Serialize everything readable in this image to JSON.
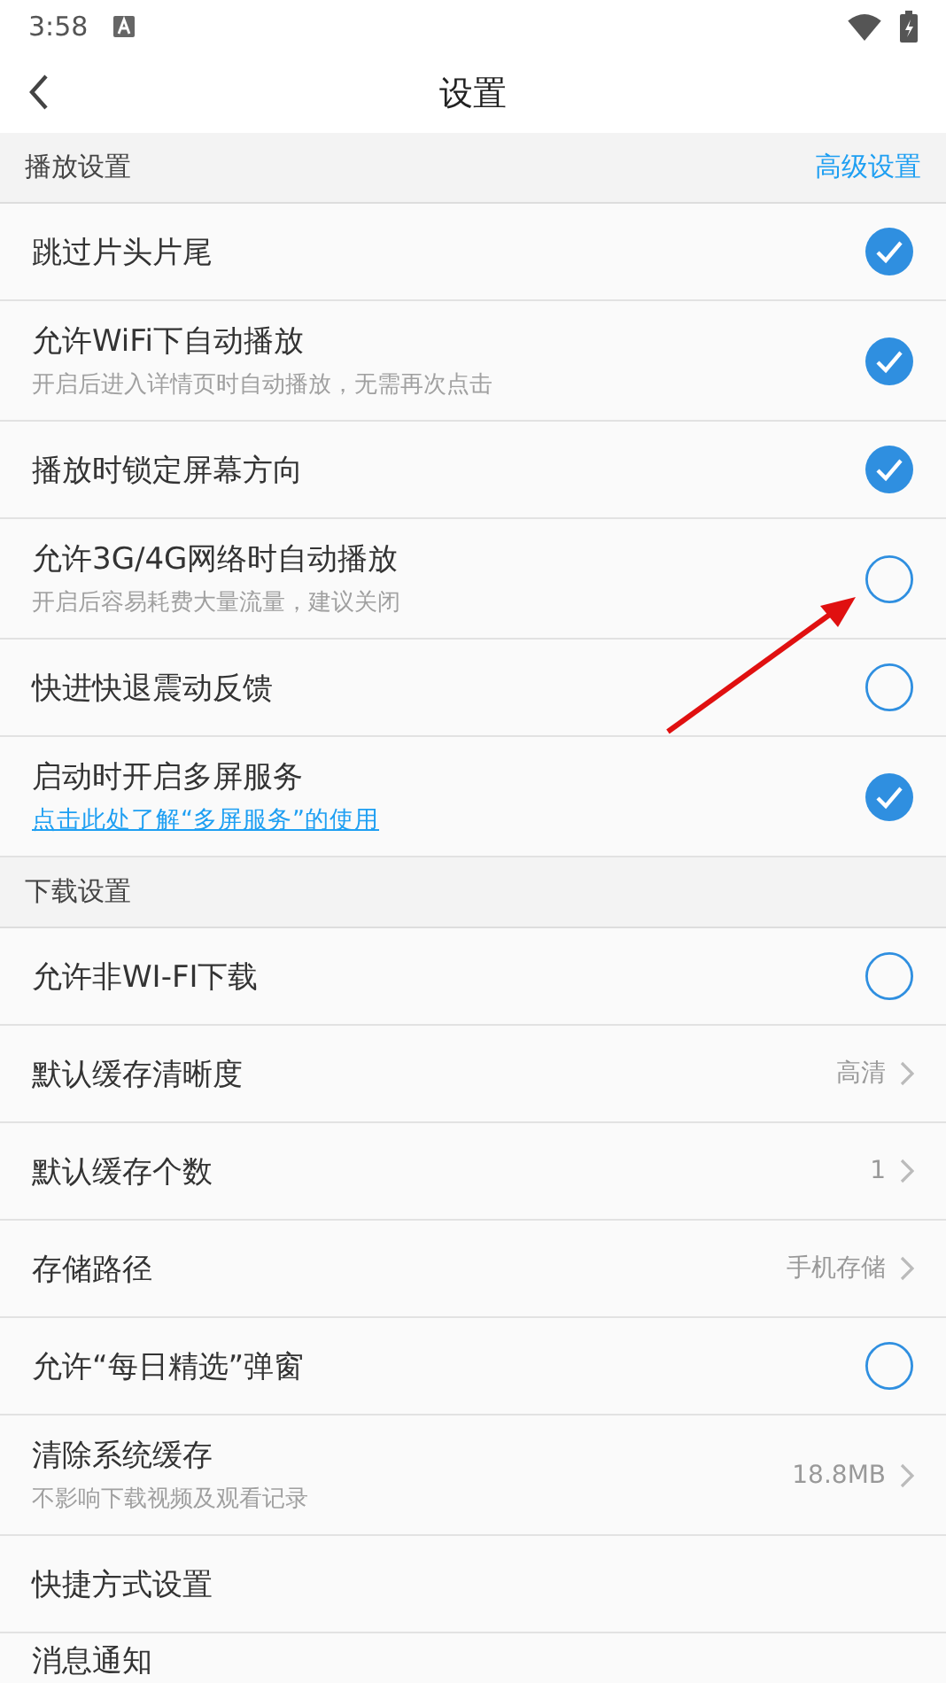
{
  "status_bar": {
    "time": "3:58"
  },
  "header": {
    "title": "设置"
  },
  "sections": [
    {
      "title": "播放设置",
      "action": "高级设置",
      "items": [
        {
          "kind": "check",
          "label": "跳过片头片尾",
          "checked": true
        },
        {
          "kind": "check",
          "label": "允许WiFi下自动播放",
          "subtitle": "开启后进入详情页时自动播放，无需再次点击",
          "checked": true
        },
        {
          "kind": "check",
          "label": "播放时锁定屏幕方向",
          "checked": true
        },
        {
          "kind": "check",
          "label": "允许3G/4G网络时自动播放",
          "subtitle": "开启后容易耗费大量流量，建议关闭",
          "checked": false
        },
        {
          "kind": "check",
          "label": "快进快退震动反馈",
          "checked": false
        },
        {
          "kind": "check",
          "label": "启动时开启多屏服务",
          "link": "点击此处了解“多屏服务”的使用",
          "checked": true
        }
      ]
    },
    {
      "title": "下载设置",
      "items": [
        {
          "kind": "check",
          "label": "允许非WI-FI下载",
          "checked": false
        },
        {
          "kind": "value",
          "label": "默认缓存清晰度",
          "value": "高清"
        },
        {
          "kind": "value",
          "label": "默认缓存个数",
          "value": "1"
        },
        {
          "kind": "value",
          "label": "存储路径",
          "value": "手机存储"
        },
        {
          "kind": "check",
          "label": "允许“每日精选”弹窗",
          "checked": false
        },
        {
          "kind": "value",
          "label": "清除系统缓存",
          "subtitle": "不影响下载视频及观看记录",
          "value": "18.8MB"
        },
        {
          "kind": "plain",
          "label": "快捷方式设置"
        },
        {
          "kind": "plain",
          "label": "消息通知"
        }
      ]
    }
  ],
  "annotations": [
    {
      "kind": "arrow"
    }
  ]
}
